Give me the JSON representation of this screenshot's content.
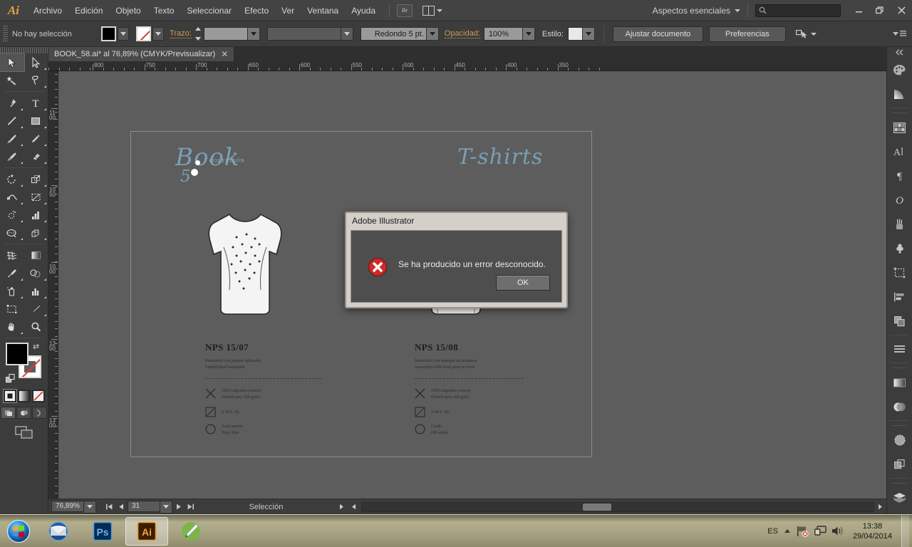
{
  "app": {
    "name": "Adobe Illustrator",
    "logo": "Ai"
  },
  "menubar": {
    "items": [
      "Archivo",
      "Edición",
      "Objeto",
      "Texto",
      "Seleccionar",
      "Efecto",
      "Ver",
      "Ventana",
      "Ayuda"
    ],
    "bridge_label": "Br",
    "workspace": "Aspectos esenciales",
    "search_placeholder": "",
    "window_buttons": {
      "minimize": "—",
      "restore": "❐",
      "close": "✕"
    }
  },
  "controlbar": {
    "selection_status": "No hay selección",
    "stroke_label": "Trazo:",
    "stroke_weight": "",
    "stroke_profile": "",
    "brush": "Redondo 5 pt.",
    "opacity_label": "Opacidad:",
    "opacity_value": "100%",
    "style_label": "Estilo:",
    "fit_document": "Ajustar documento",
    "preferences": "Preferencias"
  },
  "document": {
    "tab_label": "BOOK_58.ai* al 76,89% (CMYK/Previsualizar)",
    "tab_close": "✕"
  },
  "rulers": {
    "horizontal": [
      "800",
      "750",
      "700",
      "650",
      "600",
      "550",
      "500",
      "450",
      "400",
      "350"
    ],
    "vertical": [
      "1100",
      "1050",
      "1000",
      "1250",
      "1300"
    ]
  },
  "artboard": {
    "brand_name": "Book",
    "brand_number": "5",
    "brand_sub": "COLECCIÓN",
    "section_title": "T-shirts",
    "products": [
      {
        "code": "NPS 15/07",
        "desc_es": "Sweatshirt con piedras aplicadas",
        "desc_en": "Embellished sweatshirt",
        "composition_es": "100% algodón (cotton)",
        "composition_en": "French terry 260 g/m2",
        "sizes": "S-M-L-XL",
        "color_es": "Azul marino",
        "color_en": "Navy blue"
      },
      {
        "code": "NPS 15/08",
        "desc_es": "Sweatshirt con estampa en delantera",
        "desc_en": "Sweatshirt with local print on front",
        "composition_es": "100% algodón (cotton)",
        "composition_en": "French terry 260 g/m2",
        "sizes": "S-M-L-XL",
        "color_es": "Crudo",
        "color_en": "Off-white"
      }
    ]
  },
  "dialog": {
    "title": "Adobe Illustrator",
    "message": "Se ha producido un error desconocido.",
    "ok_label": "OK",
    "icon": "error-icon"
  },
  "statusbar": {
    "zoom": "76,89%",
    "artboard_number": "31",
    "tool_status": "Selección"
  },
  "taskbar": {
    "apps": [
      "thunderbird",
      "photoshop",
      "illustrator",
      "notes"
    ],
    "language": "ES",
    "time": "13:38",
    "date": "29/04/2014"
  },
  "colors": {
    "accent_orange": "#d09a5a",
    "brand_blue": "#7a9fb5",
    "chrome": "#3c3c3c",
    "canvas": "#5d5d5d",
    "error_red": "#cc2b2b"
  },
  "toolbox": {
    "tools": [
      "selection-tool",
      "direct-selection-tool",
      "magic-wand-tool",
      "lasso-tool",
      "pen-tool",
      "type-tool",
      "line-tool",
      "rectangle-tool",
      "paintbrush-tool",
      "pencil-tool",
      "blob-brush-tool",
      "eraser-tool",
      "rotate-tool",
      "scale-tool",
      "width-tool",
      "free-transform-tool",
      "symbol-sprayer-tool",
      "column-graph-tool",
      "artboard-tool",
      "slice-tool",
      "perspective-grid-tool",
      "gradient-mesh-tool",
      "eyedropper-tool",
      "blend-tool",
      "gradient-tool",
      "chart-tool",
      "crop-tool",
      "knife-tool",
      "hand-tool",
      "zoom-tool"
    ]
  },
  "rightpanel": {
    "icons": [
      "color-panel-icon",
      "gradient-panel-icon",
      "swatches-panel-icon",
      "character-panel-icon",
      "paragraph-panel-icon",
      "glyphs-panel-icon",
      "brushes-panel-icon",
      "symbols-panel-icon",
      "artboards-panel-icon",
      "align-panel-icon",
      "pathfinder-panel-icon",
      "transform-panel-icon",
      "stroke-panel-icon",
      "transparency-panel-icon",
      "appearance-panel-icon",
      "graphic-styles-panel-icon",
      "layers-panel-icon",
      "links-panel-icon"
    ]
  }
}
